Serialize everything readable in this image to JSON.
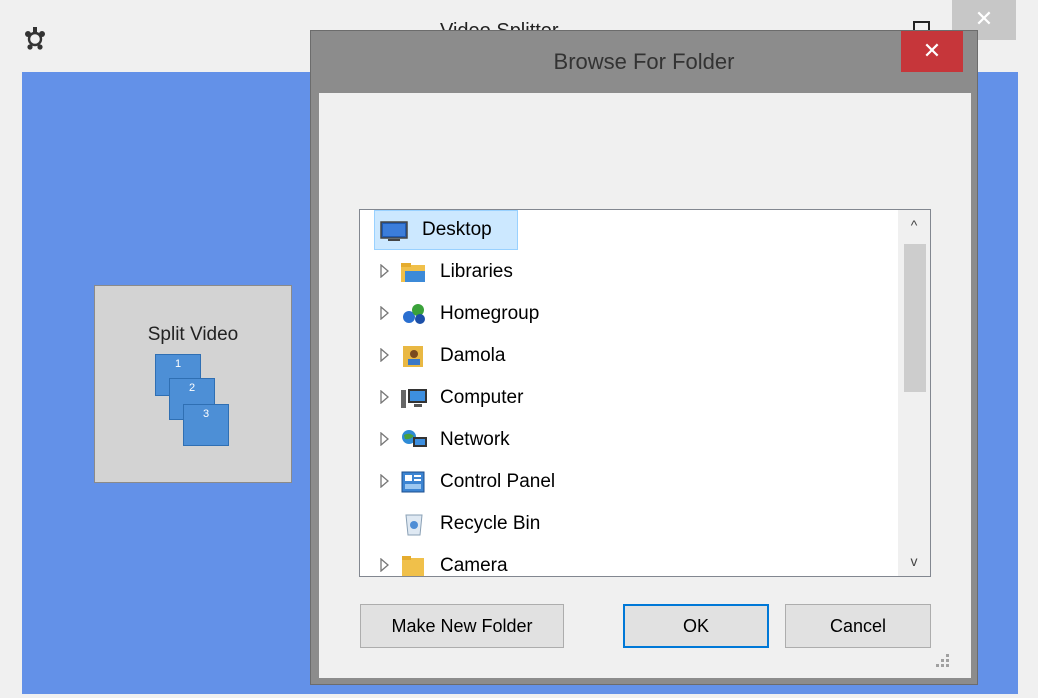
{
  "main_window": {
    "title": "Video Splitter",
    "close_glyph": "✕",
    "tile": {
      "label": "Split Video",
      "stack_numbers": [
        "1",
        "2",
        "3"
      ]
    }
  },
  "dialog": {
    "title": "Browse For Folder",
    "close_glyph": "✕",
    "tree": {
      "items": [
        {
          "label": "Desktop",
          "icon": "desktop-icon",
          "expandable": false,
          "selected": true
        },
        {
          "label": "Libraries",
          "icon": "libraries-icon",
          "expandable": true
        },
        {
          "label": "Homegroup",
          "icon": "homegroup-icon",
          "expandable": true
        },
        {
          "label": "Damola",
          "icon": "user-folder-icon",
          "expandable": true
        },
        {
          "label": "Computer",
          "icon": "computer-icon",
          "expandable": true
        },
        {
          "label": "Network",
          "icon": "network-icon",
          "expandable": true
        },
        {
          "label": "Control Panel",
          "icon": "control-panel-icon",
          "expandable": true
        },
        {
          "label": "Recycle Bin",
          "icon": "recycle-bin-icon",
          "expandable": false
        },
        {
          "label": "Camera",
          "icon": "folder-icon",
          "expandable": true
        }
      ],
      "scroll_up_glyph": "^",
      "scroll_down_glyph": "v"
    },
    "buttons": {
      "make_new_folder": "Make New Folder",
      "ok": "OK",
      "cancel": "Cancel"
    }
  },
  "colors": {
    "main_body_bg": "#6391e8",
    "dialog_frame": "#8c8c8c",
    "close_red": "#c6363a",
    "selection_bg": "#cce8ff",
    "default_button_border": "#0078d7"
  }
}
